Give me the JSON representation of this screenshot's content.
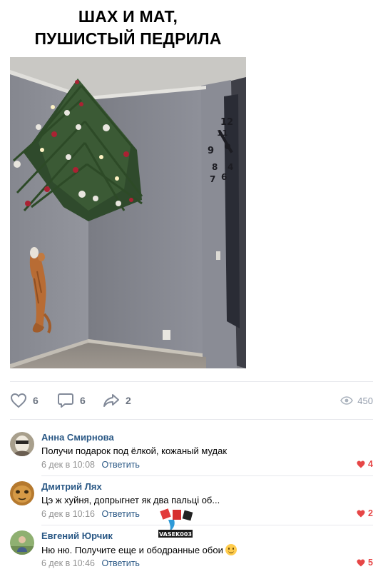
{
  "meme": {
    "caption_line1": "ШАХ И МАТ,",
    "caption_line2": "ПУШИСТЫЙ ПЕДРИЛА"
  },
  "post_actions": {
    "likes": "6",
    "comments": "6",
    "shares": "2",
    "views": "450"
  },
  "comments": [
    {
      "author": "Анна Смирнова",
      "text": "Получи подарок под ёлкой, кожаный мудак",
      "date": "6 дек в 10:08",
      "reply_label": "Ответить",
      "likes": "4"
    },
    {
      "author": "Дмитрий Лях",
      "text": "Цэ ж хуйня, допрыгнет як два пальці об...",
      "date": "6 дек в 10:16",
      "reply_label": "Ответить",
      "likes": "2"
    },
    {
      "author": "Евгений Юрчик",
      "text": "Ню ню. Получите еще и ободранные обои",
      "date": "6 дек в 10:46",
      "reply_label": "Ответить",
      "likes": "5"
    }
  ],
  "watermark": {
    "text": "VASEK003"
  },
  "colors": {
    "link": "#2a5885",
    "meta": "#939393",
    "icon": "#828a99",
    "like_red": "#e64646",
    "divider": "#e7e8ec"
  }
}
